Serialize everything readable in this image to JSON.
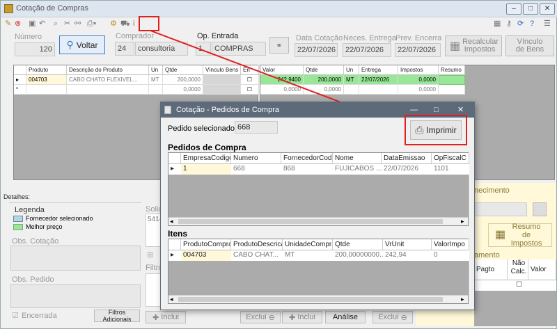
{
  "window": {
    "title": "Cotação de Compras"
  },
  "toolbar": {
    "info_icon": "i"
  },
  "header": {
    "numero_label": "Número",
    "numero_value": "120",
    "voltar_label": "Voltar",
    "comprador_label": "Comprador",
    "comprador_code": "24",
    "comprador_name": "consultoria",
    "op_entrada_label": "Op. Entrada",
    "op_entrada_code": "1",
    "op_entrada_name": "COMPRAS",
    "data_cotacao_label": "Data Cotação",
    "data_cotacao_value": "22/07/2026",
    "neces_entrega_label": "Neces. Entrega",
    "neces_entrega_value": "22/07/2026",
    "prev_encerra_label": "Prev. Encerra",
    "prev_encerra_value": "22/07/2026",
    "recalcular_label": "Recalcular Impostos",
    "vinculo_label": "Vínculo de Bens"
  },
  "left_grid": {
    "headers": [
      "Produto",
      "Descrição do Produto",
      "Un",
      "Qtde",
      "Vínculo Bens",
      "En"
    ],
    "row1": [
      "004703",
      "CABO CHATO FLEXIVEL...",
      "MT",
      "200,0000",
      ""
    ],
    "row2": [
      "",
      "",
      "",
      "0,0000",
      ""
    ]
  },
  "right_grid": {
    "headers": [
      "Valor",
      "Qtde",
      "Un",
      "Entrega",
      "Impostos",
      "Resumo"
    ],
    "row1": [
      "242,9400",
      "200,0000",
      "MT",
      "22/07/2026",
      "0,0000"
    ],
    "row2": [
      "0,0000",
      "0,0000",
      "",
      "",
      "0,0000"
    ]
  },
  "details": {
    "label": "Detalhes:",
    "legenda": "Legenda",
    "fornecedor_sel": "Fornecedor selecionado",
    "melhor_preco": "Melhor preço",
    "obs_cotacao": "Obs. Cotação",
    "obs_pedido": "Obs. Pedido",
    "encerrada": "Encerrada",
    "filtros_adicionais": "Filtros Adicionais",
    "soli_label": "Solic",
    "soli_value": "541-",
    "filtro_label": "Filtro",
    "incluir": "Inclui",
    "excluir": "Exclui",
    "analise": "Análise",
    "fornecimento": "necimento",
    "resumo_impostos": "Resumo de Impostos",
    "pagamento": "amento",
    "pagto": "Pagto",
    "nao_calc": "Não Calc.",
    "valor": "Valor"
  },
  "dialog": {
    "title": "Cotação - Pedidos de Compra",
    "pedido_sel_label": "Pedido selecionado:",
    "pedido_sel_value": "668",
    "imprimir": "Imprimir",
    "pedidos_title": "Pedidos de Compra",
    "pedidos_headers": [
      "EmpresaCodigo",
      "Numero",
      "FornecedorCodigo",
      "Nome",
      "DataEmissao",
      "OpFiscalC"
    ],
    "pedidos_row": [
      "1",
      "668",
      "868",
      "FUJICABOS ...",
      "22/07/2026",
      "1101"
    ],
    "itens_title": "Itens",
    "itens_headers": [
      "ProdutoCompra",
      "ProdutoDescricao",
      "UnidadeCompra",
      "Qtde",
      "VrUnit",
      "ValorImpo"
    ],
    "itens_row": [
      "004703",
      "CABO CHAT...",
      "MT",
      "200,00000000...",
      "242,94",
      "0"
    ]
  },
  "colors": {
    "annotation": "#e02020",
    "highlight_green": "#99e699",
    "highlight_yellow": "#fff9d9",
    "selected_blue": "#add8e6"
  }
}
